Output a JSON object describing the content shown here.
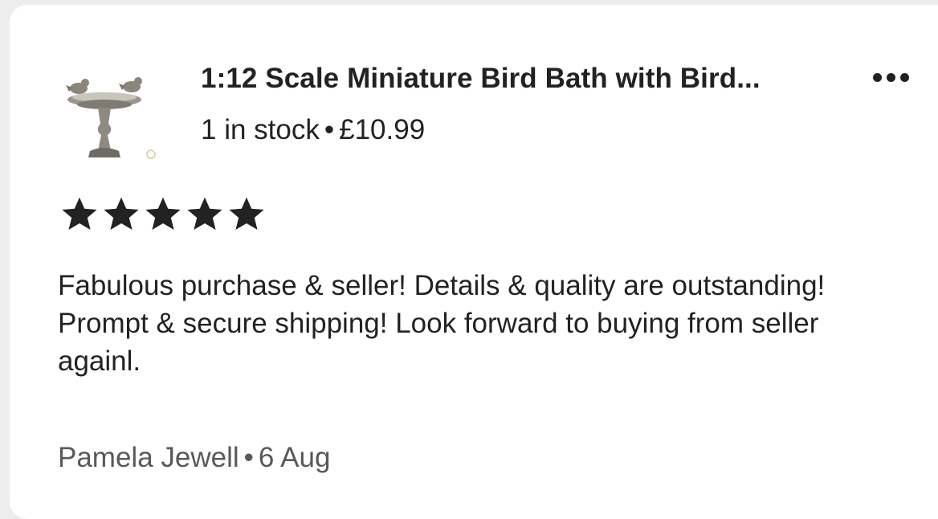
{
  "listing": {
    "title": "1:12 Scale Miniature Bird Bath with Bird...",
    "stock": "1 in stock",
    "separator": "•",
    "price": "£10.99",
    "thumbnail_icon": "bird-bath-image"
  },
  "menu": {
    "icon": "more-options-icon"
  },
  "review": {
    "rating": 5,
    "rating_max": 5,
    "star_color": "#222222",
    "text": "Fabulous purchase & seller! Details & quality are outstanding! Prompt & secure shipping! Look forward to buying from seller againl.",
    "author": "Pamela Jewell",
    "separator": "•",
    "date": "6 Aug"
  }
}
